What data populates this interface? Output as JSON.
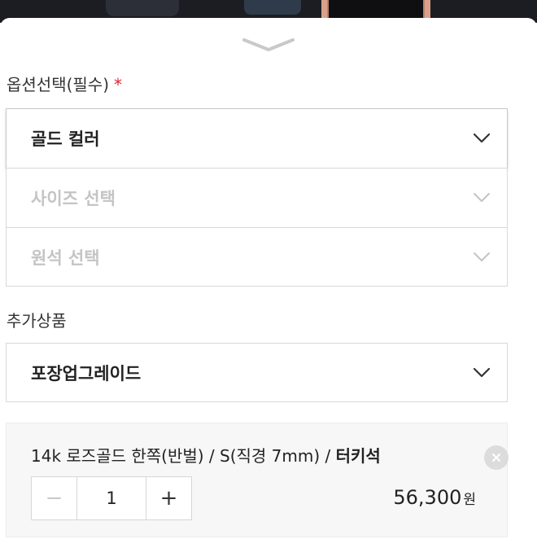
{
  "options": {
    "label": "옵션선택(필수)",
    "required_mark": "*",
    "selects": [
      {
        "text": "골드 컬러",
        "state": "selected"
      },
      {
        "text": "사이즈 선택",
        "state": "disabled"
      },
      {
        "text": "원석 선택",
        "state": "disabled"
      }
    ]
  },
  "extras": {
    "label": "추가상품",
    "select_text": "포장업그레이드"
  },
  "cart_item": {
    "title_prefix": "14k 로즈골드 한쪽(반벌) / S(직경 7mm) / ",
    "title_strong": "터키석",
    "quantity": "1",
    "minus_label": "−",
    "plus_label": "+",
    "price": "56,300",
    "currency": "원"
  },
  "icons": {
    "handle": "chevron-down-icon",
    "select_arrow": "chevron-down-icon",
    "remove": "close-icon"
  },
  "colors": {
    "required": "#e0242f",
    "disabled_text": "#c4c4c4",
    "cart_bg": "#f7f7f7"
  }
}
